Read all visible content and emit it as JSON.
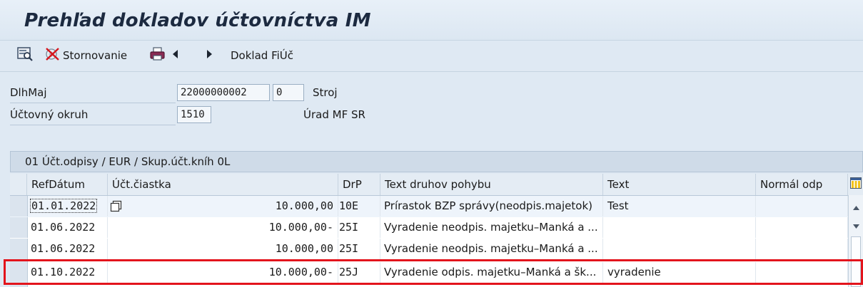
{
  "window": {
    "title": "Prehľad dokladov účtovníctva IM"
  },
  "toolbar": {
    "storno_label": "Stornovanie",
    "doklad_label": "Doklad FiÚč"
  },
  "header": {
    "asset_label": "DlhMaj",
    "asset_main": "22000000002",
    "asset_sub": "0",
    "asset_desc": "Stroj",
    "company_label": "Účtovný okruh",
    "company_code": "1510",
    "company_desc": "Úrad MF SR"
  },
  "panel": {
    "title": "01 Účt.odpisy / EUR / Skup.účt.kníh 0L"
  },
  "table": {
    "columns": [
      "RefDátum",
      "Účt.čiastka",
      "DrP",
      "Text druhov pohybu",
      "Text",
      "Normál odp"
    ],
    "rows": [
      {
        "date": "01.01.2022",
        "amount": "10.000,00",
        "drp": "10E",
        "movement": "Prírastok BZP správy(neodpis.majetok)",
        "text": "Test",
        "normal": ""
      },
      {
        "date": "01.06.2022",
        "amount": "10.000,00-",
        "drp": "25I",
        "movement": "Vyradenie neodpis. majetku–Manká a ...",
        "text": "",
        "normal": ""
      },
      {
        "date": "01.06.2022",
        "amount": "10.000,00",
        "drp": "25I",
        "movement": "Vyradenie neodpis. majetku–Manká a ...",
        "text": "",
        "normal": ""
      },
      {
        "date": "01.10.2022",
        "amount": "10.000,00-",
        "drp": "25J",
        "movement": "Vyradenie odpis. majetku–Manká a šk...",
        "text": "vyradenie",
        "normal": ""
      }
    ]
  },
  "icons": [
    "display-icon",
    "storno-icon",
    "print-icon",
    "arrow-left-icon",
    "arrow-right-icon",
    "column-layout-icon",
    "copy-icon",
    "scroll-up-icon",
    "scroll-down-icon"
  ],
  "colors": {
    "highlight": "#e3141c",
    "background": "#dfe9f3"
  }
}
